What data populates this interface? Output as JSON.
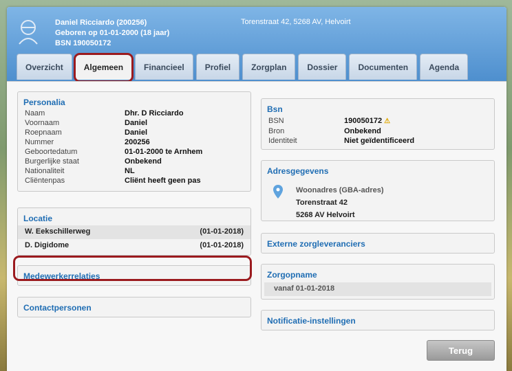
{
  "patient": {
    "name_line": "Daniel Ricciardo (200256)",
    "birth_line": "Geboren op 01-01-2000 (18 jaar)",
    "bsn_line": "BSN 190050172",
    "address": "Torenstraat 42, 5268 AV, Helvoirt"
  },
  "tabs": [
    "Overzicht",
    "Algemeen",
    "Financieel",
    "Profiel",
    "Zorgplan",
    "Dossier",
    "Documenten",
    "Agenda"
  ],
  "active_tab": "Algemeen",
  "personalia": {
    "title": "Personalia",
    "rows": [
      {
        "k": "Naam",
        "v": "Dhr. D Ricciardo"
      },
      {
        "k": "Voornaam",
        "v": "Daniel"
      },
      {
        "k": "Roepnaam",
        "v": "Daniel"
      },
      {
        "k": "Nummer",
        "v": "200256"
      },
      {
        "k": "Geboortedatum",
        "v": "01-01-2000 te Arnhem"
      },
      {
        "k": "Burgerlijke staat",
        "v": "Onbekend"
      },
      {
        "k": "Nationaliteit",
        "v": "NL"
      },
      {
        "k": "Cliëntenpas",
        "v": "Cliënt heeft geen pas"
      }
    ]
  },
  "locatie": {
    "title": "Locatie",
    "rows": [
      {
        "name": "W. Eekschillerweg",
        "date": "(01-01-2018)"
      },
      {
        "name": "D. Digidome",
        "date": "(01-01-2018)"
      }
    ]
  },
  "medewerkerrelaties": {
    "title": "Medewerkerrelaties"
  },
  "contactpersonen": {
    "title": "Contactpersonen"
  },
  "bsn": {
    "title": "Bsn",
    "rows": [
      {
        "k": "BSN",
        "v": "190050172"
      },
      {
        "k": "Bron",
        "v": "Onbekend"
      },
      {
        "k": "Identiteit",
        "v": "Niet geïdentificeerd"
      }
    ]
  },
  "adres": {
    "title": "Adresgegevens",
    "type": "Woonadres (GBA-adres)",
    "street": "Torenstraat 42",
    "city": "5268 AV Helvoirt"
  },
  "externe": {
    "title": "Externe zorgleveranciers"
  },
  "zorgopname": {
    "title": "Zorgopname",
    "value": "vanaf 01-01-2018"
  },
  "notificatie": {
    "title": "Notificatie-instellingen"
  },
  "buttons": {
    "terug": "Terug"
  },
  "colors": {
    "accent": "#1f6db3",
    "highlight": "#9b1a1e",
    "header": "#4e8fce"
  }
}
